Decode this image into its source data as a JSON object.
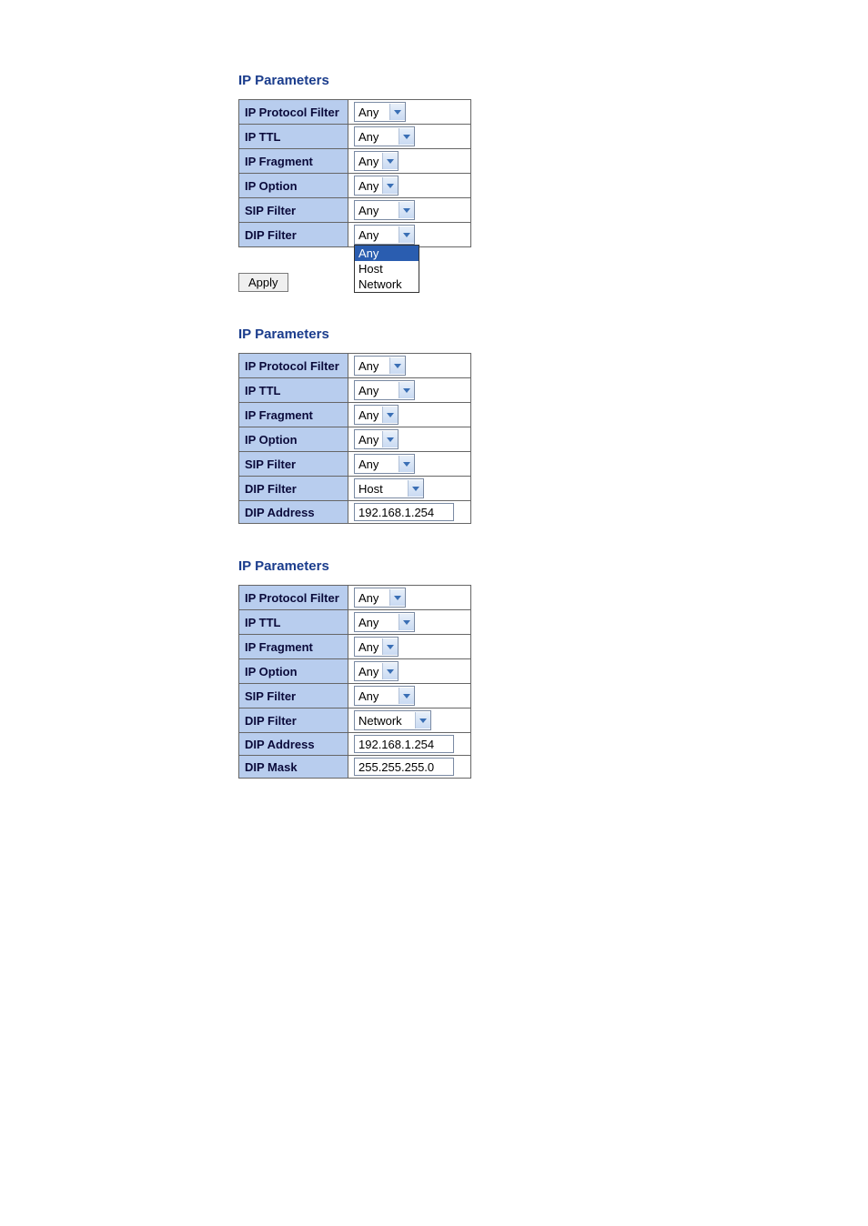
{
  "sectionTitle": "IP Parameters",
  "labels": {
    "ipProtocolFilter": "IP Protocol Filter",
    "ipTTL": "IP TTL",
    "ipFragment": "IP Fragment",
    "ipOption": "IP Option",
    "sipFilter": "SIP Filter",
    "dipFilter": "DIP Filter",
    "dipAddress": "DIP Address",
    "dipMask": "DIP Mask"
  },
  "block1": {
    "ipProtocolFilter": "Any",
    "ipTTL": "Any",
    "ipFragment": "Any",
    "ipOption": "Any",
    "sipFilter": "Any",
    "dipFilter": "Any",
    "dropdownOpen": {
      "opt0": "Any",
      "opt1": "Host",
      "opt2": "Network"
    },
    "applyLabel": "Apply"
  },
  "block2": {
    "ipProtocolFilter": "Any",
    "ipTTL": "Any",
    "ipFragment": "Any",
    "ipOption": "Any",
    "sipFilter": "Any",
    "dipFilter": "Host",
    "dipAddress": "192.168.1.254"
  },
  "block3": {
    "ipProtocolFilter": "Any",
    "ipTTL": "Any",
    "ipFragment": "Any",
    "ipOption": "Any",
    "sipFilter": "Any",
    "dipFilter": "Network",
    "dipAddress": "192.168.1.254",
    "dipMask": "255.255.255.0"
  }
}
